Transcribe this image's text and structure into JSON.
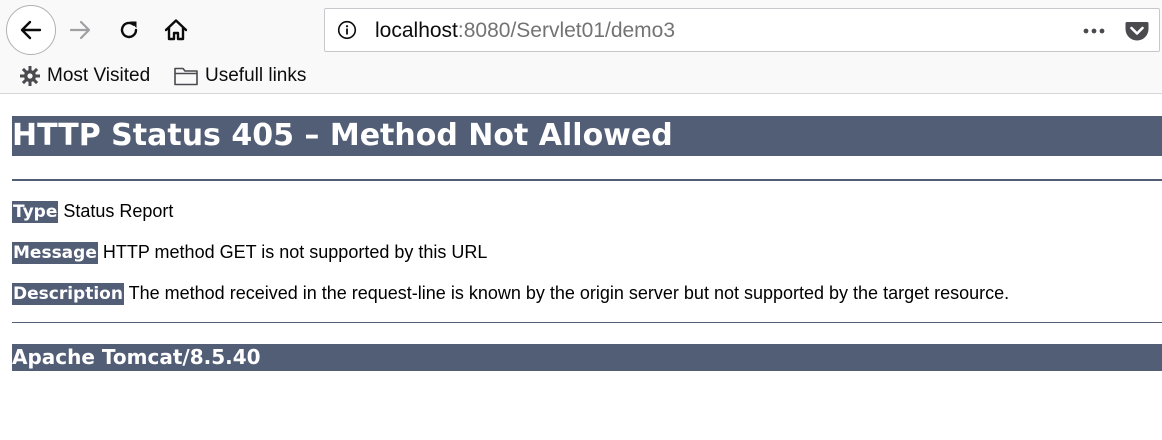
{
  "browser": {
    "url_host": "localhost",
    "url_rest": ":8080/Servlet01/demo3",
    "icons": {
      "back": "arrow-left-icon",
      "forward": "arrow-right-icon",
      "reload": "reload-icon",
      "home": "home-icon",
      "site_info": "info-icon",
      "page_actions": "ellipsis-icon",
      "pocket": "pocket-icon"
    },
    "bookmarks": [
      {
        "label": "Most Visited",
        "icon": "gear-icon"
      },
      {
        "label": "Usefull links",
        "icon": "folder-icon"
      }
    ]
  },
  "page": {
    "title": "HTTP Status 405 – Method Not Allowed",
    "type_label": "Type",
    "type_value": "Status Report",
    "message_label": "Message",
    "message_value": "HTTP method GET is not supported by this URL",
    "description_label": "Description",
    "description_value": "The method received in the request-line is known by the origin server but not supported by the target resource.",
    "footer": "Apache Tomcat/8.5.40"
  },
  "colors": {
    "accent": "#525d76",
    "chrome_bg": "#f9f9fa"
  }
}
